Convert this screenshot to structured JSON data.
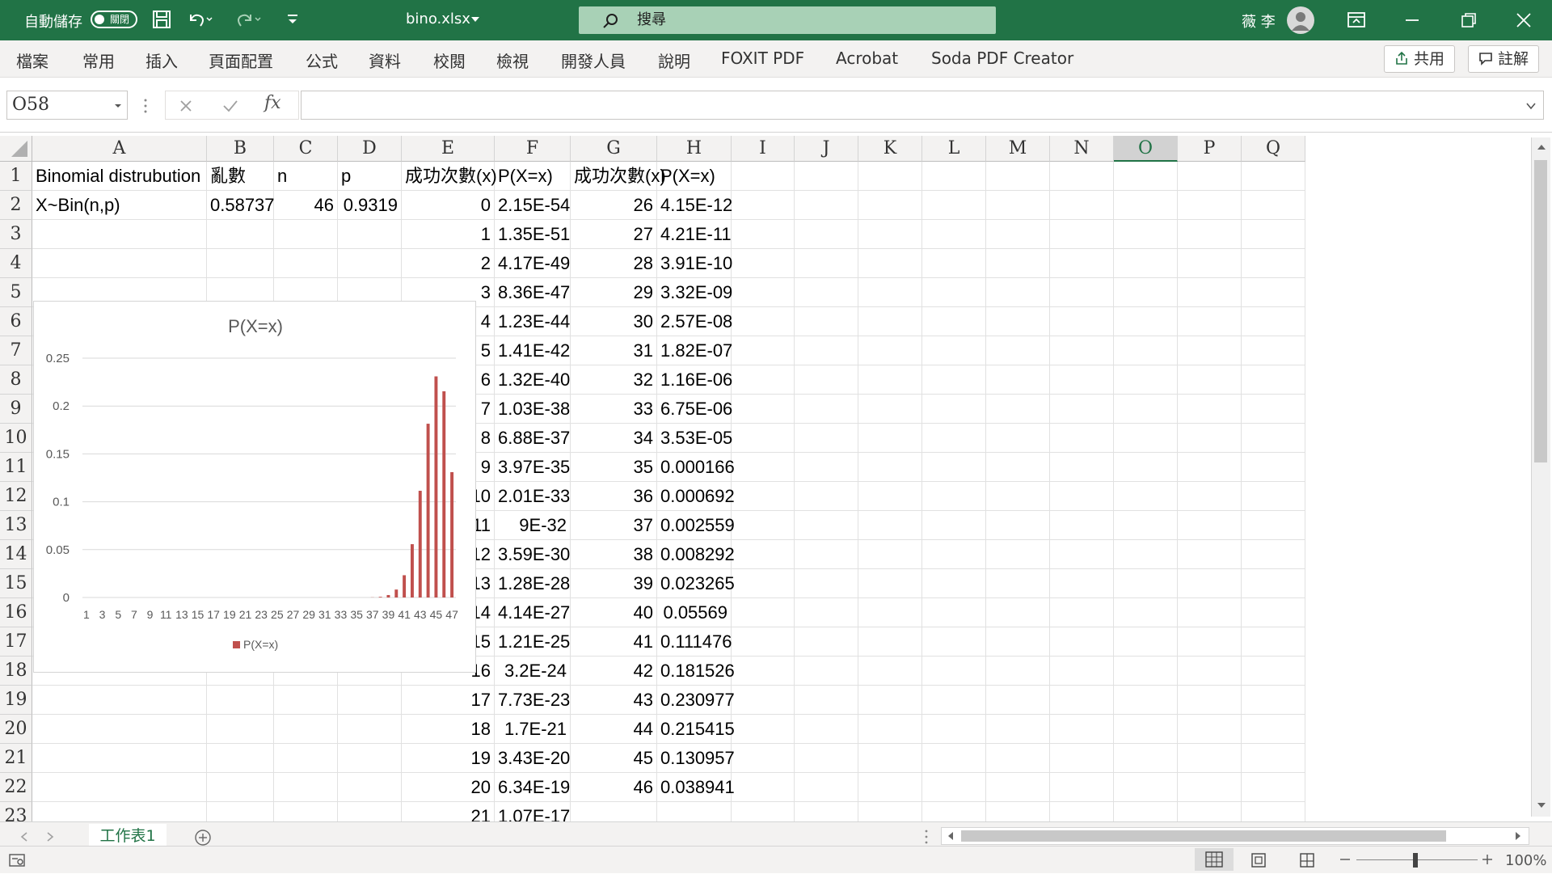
{
  "titlebar": {
    "autosave_label": "自動儲存",
    "autosave_state": "關閉",
    "filename": "bino.xlsx",
    "search_placeholder": "搜尋",
    "user_name": "薇 李"
  },
  "ribbon": {
    "tabs": [
      "檔案",
      "常用",
      "插入",
      "頁面配置",
      "公式",
      "資料",
      "校閱",
      "檢視",
      "開發人員",
      "說明",
      "FOXIT PDF",
      "Acrobat",
      "Soda PDF Creator"
    ],
    "share_label": "共用",
    "comment_label": "註解"
  },
  "formula": {
    "namebox_value": "O58",
    "fx_label": "fx",
    "formula_value": ""
  },
  "columns": [
    "A",
    "B",
    "C",
    "D",
    "E",
    "F",
    "G",
    "H",
    "I",
    "J",
    "K",
    "L",
    "M",
    "N",
    "O",
    "P",
    "Q"
  ],
  "rows": [
    "1",
    "2",
    "3",
    "4",
    "5",
    "6",
    "7",
    "8",
    "9",
    "10",
    "11",
    "12",
    "13",
    "14",
    "15",
    "16",
    "17",
    "18",
    "19",
    "20",
    "21",
    "22",
    "23"
  ],
  "sheet": {
    "header": [
      "Binomial distrubution",
      "亂數",
      "n",
      "p",
      "成功次數(x)",
      "P(X=x)",
      "成功次數(x)",
      "P(X=x)"
    ],
    "row2": {
      "a": "X~Bin(n,p)",
      "b": "0.58737",
      "c": "46",
      "d": "0.9319"
    },
    "e": [
      "0",
      "1",
      "2",
      "3",
      "4",
      "5",
      "6",
      "7",
      "8",
      "9",
      "10",
      "11",
      "12",
      "13",
      "14",
      "15",
      "16",
      "17",
      "18",
      "19",
      "20",
      "21"
    ],
    "f": [
      "2.15E-54",
      "1.35E-51",
      "4.17E-49",
      "8.36E-47",
      "1.23E-44",
      "1.41E-42",
      "1.32E-40",
      "1.03E-38",
      "6.88E-37",
      "3.97E-35",
      "2.01E-33",
      "9E-32",
      "3.59E-30",
      "1.28E-28",
      "4.14E-27",
      "1.21E-25",
      "3.2E-24",
      "7.73E-23",
      "1.7E-21",
      "3.43E-20",
      "6.34E-19",
      "1.07E-17"
    ],
    "g": [
      "26",
      "27",
      "28",
      "29",
      "30",
      "31",
      "32",
      "33",
      "34",
      "35",
      "36",
      "37",
      "38",
      "39",
      "40",
      "41",
      "42",
      "43",
      "44",
      "45",
      "46"
    ],
    "h": [
      "4.15E-12",
      "4.21E-11",
      "3.91E-10",
      "3.32E-09",
      "2.57E-08",
      "1.82E-07",
      "1.16E-06",
      "6.75E-06",
      "3.53E-05",
      "0.000166",
      "0.000692",
      "0.002559",
      "0.008292",
      "0.023265",
      "0.05569",
      "0.111476",
      "0.181526",
      "0.230977",
      "0.215415",
      "0.130957",
      "0.038941"
    ]
  },
  "chart_data": {
    "type": "bar",
    "title": "P(X=x)",
    "legend": "P(X=x)",
    "legend_position": "bottom",
    "bar_color": "#c0504d",
    "ylim": [
      0,
      0.25
    ],
    "yticks": [
      "0",
      "0.05",
      "0.1",
      "0.15",
      "0.2",
      "0.25"
    ],
    "categories": [
      "1",
      "2",
      "3",
      "4",
      "5",
      "6",
      "7",
      "8",
      "9",
      "10",
      "11",
      "12",
      "13",
      "14",
      "15",
      "16",
      "17",
      "18",
      "19",
      "20",
      "21",
      "22",
      "23",
      "24",
      "25",
      "26",
      "27",
      "28",
      "29",
      "30",
      "31",
      "32",
      "33",
      "34",
      "35",
      "36",
      "37",
      "38",
      "39",
      "40",
      "41",
      "42",
      "43",
      "44",
      "45",
      "46",
      "47"
    ],
    "xticks": [
      "1",
      "3",
      "5",
      "7",
      "9",
      "11",
      "13",
      "15",
      "17",
      "19",
      "21",
      "23",
      "25",
      "27",
      "29",
      "31",
      "33",
      "35",
      "37",
      "39",
      "41",
      "43",
      "45",
      "47"
    ],
    "values": [
      0,
      0,
      0,
      0,
      0,
      0,
      0,
      0,
      0,
      0,
      0,
      0,
      0,
      0,
      0,
      0,
      0,
      0,
      0,
      0,
      0,
      0,
      0,
      0,
      0,
      0,
      0,
      0,
      0,
      0,
      0,
      0,
      0,
      0,
      0,
      0,
      0.000166,
      0.000692,
      0.002559,
      0.008292,
      0.023265,
      0.05569,
      0.111476,
      0.181526,
      0.230977,
      0.215415,
      0.130957,
      0.038941
    ]
  },
  "sheettab": {
    "label": "工作表1"
  },
  "status": {
    "zoom": "100%"
  }
}
